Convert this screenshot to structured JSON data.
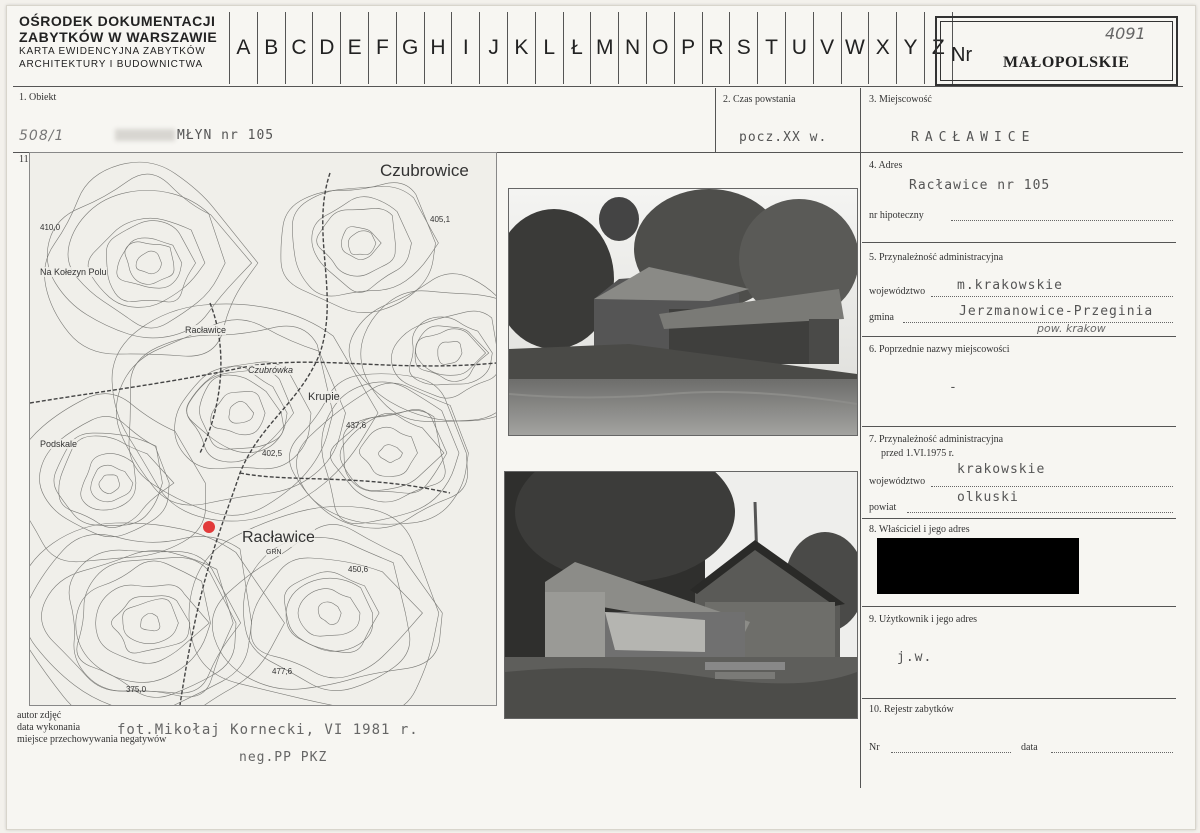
{
  "header": {
    "org_line1": "OŚRODEK DOKUMENTACJI",
    "org_line2": "ZABYTKÓW W WARSZAWIE",
    "org_line3": "KARTA EWIDENCYJNA ZABYTKÓW",
    "org_line4": "ARCHITEKTURY I BUDOWNICTWA",
    "alphabet": [
      "A",
      "B",
      "C",
      "D",
      "E",
      "F",
      "G",
      "H",
      "I",
      "J",
      "K",
      "L",
      "Ł",
      "M",
      "N",
      "O",
      "P",
      "R",
      "S",
      "T",
      "U",
      "V",
      "W",
      "X",
      "Y",
      "Z"
    ],
    "nr_label": "Nr",
    "region": "MAŁOPOLSKIE",
    "handwritten_number": "4091"
  },
  "fields": {
    "f1_label": "1. Obiekt",
    "f1_value_prefix": "508/1",
    "f1_value": "MŁYN nr 105",
    "f2_label": "2. Czas powstania",
    "f2_value": "pocz.XX w.",
    "f3_label": "3. Miejscowość",
    "f3_value": "RACŁAWICE",
    "f4_label": "4. Adres",
    "f4_value": "Racławice nr 105",
    "hipoteczny_label": "nr hipoteczny",
    "f5_label": "5. Przynależność administracyjna",
    "wojewodztwo_label": "województwo",
    "wojewodztwo_value": "m.krakowskie",
    "gmina_label": "gmina",
    "gmina_value": "Jerzmanowice-Przeginia",
    "gmina_hand": "pow. krakow",
    "f6_label": "6. Poprzednie nazwy miejscowości",
    "f6_value": "-",
    "f7_label1": "7. Przynależność administracyjna",
    "f7_label2": "przed 1.VI.1975 r.",
    "woj2_label": "województwo",
    "woj2_value": "krakowskie",
    "powiat_label": "powiat",
    "powiat_value": "olkuski",
    "f8_label": "8. Właściciel i jego adres",
    "f9_label": "9. Użytkownik i jego adres",
    "f9_value": "j.w.",
    "f10_label": "10. Rejestr zabytków",
    "rej_nr_label": "Nr",
    "rej_data_label": "data",
    "f11_label": "11."
  },
  "footer": {
    "autor_label": "autor zdjęć",
    "data_label": "data wykonania",
    "miejsce_label": "miejsce przechowywania negatywów",
    "photo_value": "fot.Mikołaj Kornecki, VI 1981 r.",
    "neg_value": "neg.PP PKZ"
  },
  "map": {
    "names": {
      "czubrowice": "Czubrowice",
      "na_kolezyn": "Na Kołezyn Polu",
      "raclawice_small": "Racławice",
      "czubrowka": "Czubrówka",
      "krupie": "Krupie",
      "podskale": "Podskale",
      "raclawice_big": "Racławice",
      "grn": "GRN"
    },
    "points": {
      "p410": "410,0",
      "p405": "405,1",
      "p437": "437,6",
      "p402": "402,5",
      "p450": "450,6",
      "p477": "477,6",
      "p375": "375,0"
    }
  },
  "colors": {
    "marker": "#e23a3a",
    "ink": "#222222",
    "typed": "#555555"
  }
}
